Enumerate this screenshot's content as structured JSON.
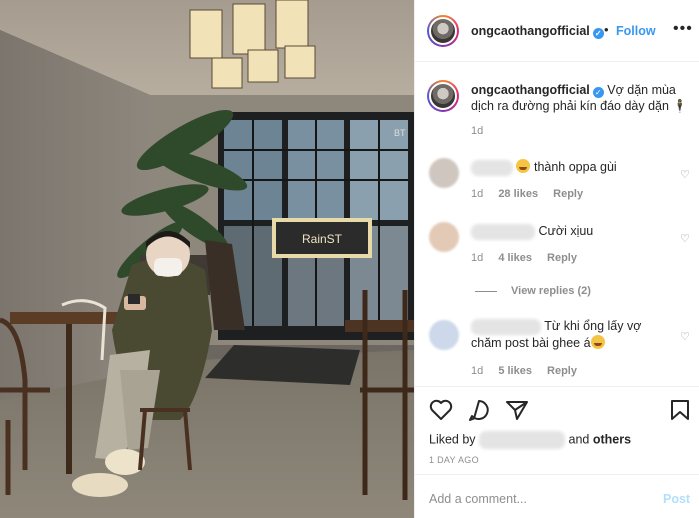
{
  "post": {
    "username": "ongcaothangofficial",
    "dot": "•",
    "follow_label": "Follow",
    "more_label": "•••"
  },
  "caption": {
    "username": "ongcaothangofficial",
    "text": "Vợ dặn mùa dịch ra đường phải kín đáo dày dặn 🕴",
    "time": "1d"
  },
  "comments": [
    {
      "text": "thành oppa gùi",
      "time": "1d",
      "likes": "28 likes",
      "reply": "Reply",
      "avatar_color": "#c9c0b8"
    },
    {
      "text": "Cười xịuu",
      "time": "1d",
      "likes": "4 likes",
      "reply": "Reply",
      "avatar_color": "#e2c9b6"
    },
    {
      "text_line1": "Từ khi ổng lấy vợ",
      "text_line2": "chăm post bài ghee á",
      "time": "1d",
      "likes": "5 likes",
      "reply": "Reply",
      "avatar_color": "#c8d4e6"
    }
  ],
  "view_replies": "View replies (2)",
  "likes": {
    "prefix": "Liked by",
    "and": "and",
    "others": "others"
  },
  "time_ago": "1 DAY AGO",
  "add_comment": {
    "placeholder": "Add a comment...",
    "post_label": "Post"
  },
  "photo_sign_text": "RainST",
  "photo_door_text": "BT"
}
